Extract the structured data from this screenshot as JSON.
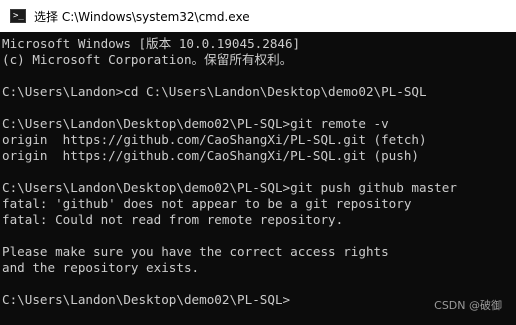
{
  "window": {
    "title": "选择 C:\\Windows\\system32\\cmd.exe",
    "icon": "cmd-icon"
  },
  "console": {
    "lines": [
      "Microsoft Windows [版本 10.0.19045.2846]",
      "(c) Microsoft Corporation。保留所有权利。",
      "",
      "C:\\Users\\Landon>cd C:\\Users\\Landon\\Desktop\\demo02\\PL-SQL",
      "",
      "C:\\Users\\Landon\\Desktop\\demo02\\PL-SQL>git remote -v",
      "origin  https://github.com/CaoShangXi/PL-SQL.git (fetch)",
      "origin  https://github.com/CaoShangXi/PL-SQL.git (push)",
      "",
      "C:\\Users\\Landon\\Desktop\\demo02\\PL-SQL>git push github master",
      "fatal: 'github' does not appear to be a git repository",
      "fatal: Could not read from remote repository.",
      "",
      "Please make sure you have the correct access rights",
      "and the repository exists.",
      "",
      "C:\\Users\\Landon\\Desktop\\demo02\\PL-SQL>"
    ]
  },
  "watermark": "CSDN @破御",
  "colors": {
    "console_background": "#0c0c0c",
    "console_text": "#cccccc",
    "titlebar_background": "#ffffff"
  }
}
